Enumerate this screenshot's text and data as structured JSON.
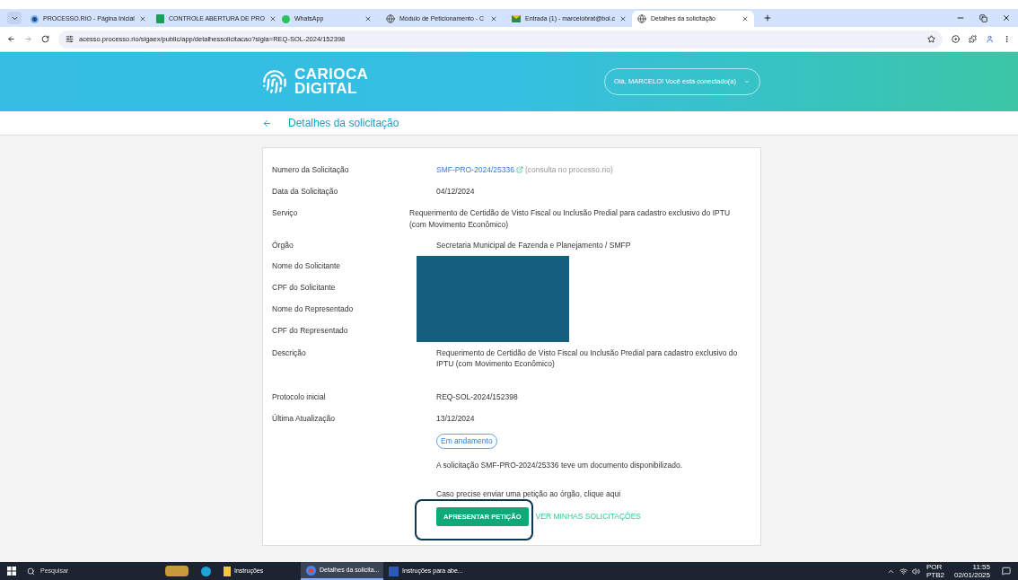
{
  "browser": {
    "tabs": [
      {
        "title": "PROCESSO.RIO - Página Inicial",
        "kind": "processo",
        "selected": false
      },
      {
        "title": "CONTROLE ABERTURA DE PRO",
        "kind": "sheets",
        "selected": false
      },
      {
        "title": "WhatsApp",
        "kind": "whatsapp",
        "selected": false
      },
      {
        "title": "Módulo de Peticionamento - C",
        "kind": "globe",
        "selected": false
      },
      {
        "title": "Entrada (1) - marcelobrat@bol.c",
        "kind": "mail",
        "selected": false
      },
      {
        "title": "Detalhes da solicitação",
        "kind": "globe",
        "selected": true
      }
    ],
    "address": "acesso.processo.rio/sigaex/public/app/detalhessolicitacao?sigla=REQ-SOL-2024/152398"
  },
  "header": {
    "brand": [
      "CARIOCA",
      "DIGITAL"
    ],
    "user_menu": "Olá, MARCELO! Você está conectado(a)"
  },
  "page_title": "Detalhes da solicitação",
  "details": [
    {
      "label": "Numero da Solicitação",
      "kind": "link",
      "value": "SMF-PRO-2024/25336",
      "note": "(consulta no processo.rio)"
    },
    {
      "label": "Data da Solicitação",
      "kind": "text",
      "value": "04/12/2024"
    },
    {
      "label": "Serviço",
      "kind": "shifted",
      "value": "Requerimento de Certidão de Visto Fiscal ou Inclusão Predial para cadastro exclusivo do IPTU (com Movimento Econômico)"
    },
    {
      "label": "Órgão",
      "kind": "text",
      "value": "Secretaria Municipal de Fazenda e Planejamento / SMFP"
    },
    {
      "label": "Nome do Solicitante",
      "kind": "redacted"
    },
    {
      "label": "CPF do Solicitante",
      "kind": "redacted"
    },
    {
      "label": "Nome do Representado",
      "kind": "redacted"
    },
    {
      "label": "CPF do Representado",
      "kind": "redacted"
    },
    {
      "label": "Descrição",
      "kind": "long",
      "value": "Requerimento de Certidão de Visto Fiscal ou Inclusão Predial para cadastro exclusivo do IPTU (com Movimento Econômico)"
    },
    {
      "label": "Protocolo inicial",
      "kind": "text",
      "value": "REQ-SOL-2024/152398"
    },
    {
      "label": "Última Atualização",
      "kind": "text",
      "value": "13/12/2024"
    }
  ],
  "status": "Em andamento",
  "message": "A solicitação SMF-PRO-2024/25336 teve um documento disponibilizado.",
  "instruction": "Caso precise enviar uma petição ao órgão, clique aqui",
  "primary_button": "APRESENTAR PETIÇÃO",
  "secondary_link": "VER MINHAS SOLICITAÇÕES",
  "taskbar": {
    "search": "Pesquisar",
    "apps": [
      {
        "label": "Instruções",
        "kind": "folder",
        "selected": false
      },
      {
        "label": "Detalhes da solicita...",
        "kind": "chrome",
        "selected": true
      },
      {
        "label": "Instruções para abe...",
        "kind": "word",
        "selected": false
      }
    ],
    "language": [
      "POR",
      "PTB2"
    ],
    "time": "11:55",
    "date": "02/01/2025"
  }
}
